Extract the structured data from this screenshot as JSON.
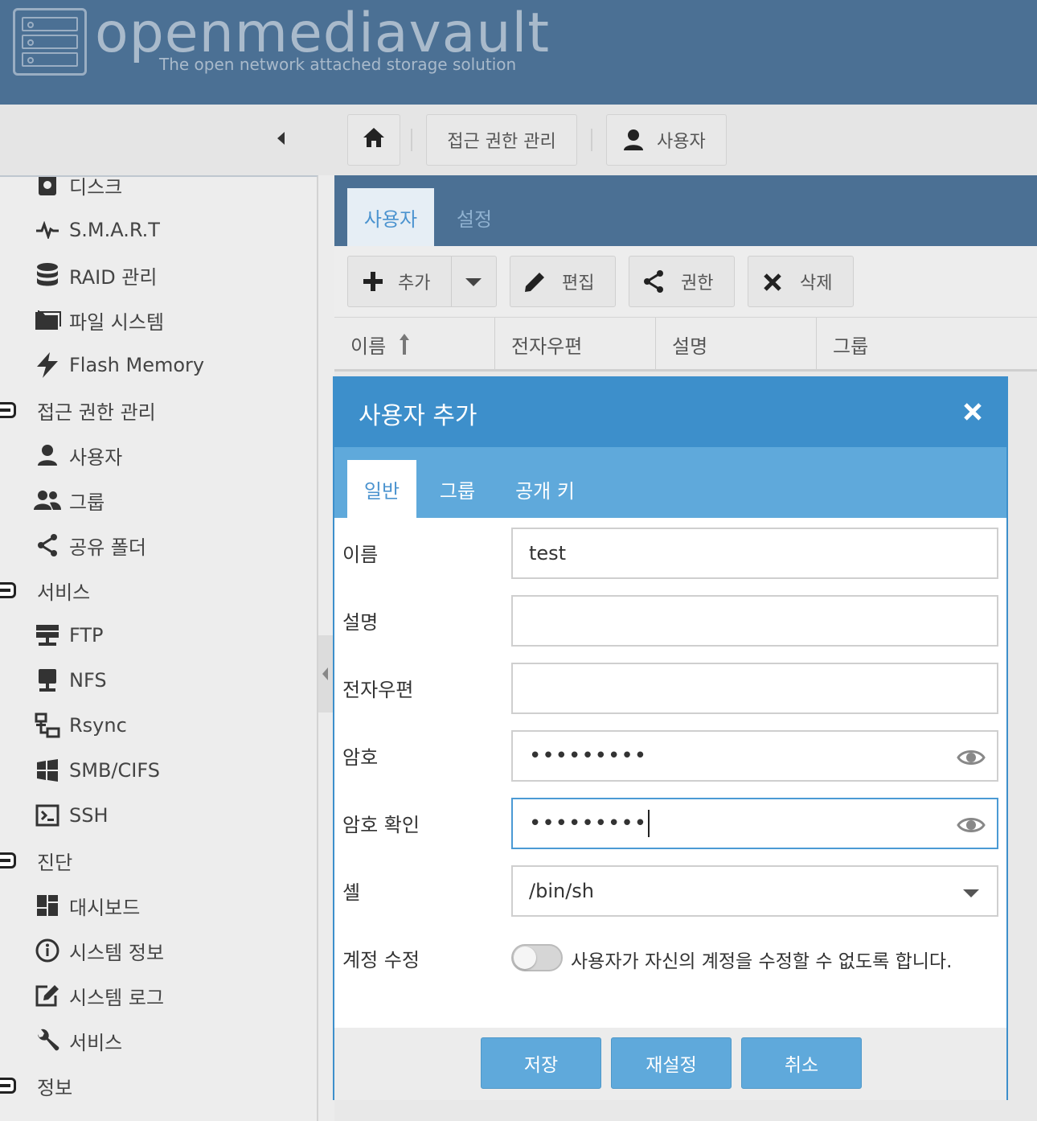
{
  "header": {
    "title": "openmediavault",
    "subtitle": "The open network attached storage solution"
  },
  "breadcrumb": {
    "home_icon": "home-icon",
    "items": [
      "접근 권한 관리",
      "사용자"
    ]
  },
  "sidebar": {
    "items": [
      {
        "label": "디스크",
        "icon": "disk-icon"
      },
      {
        "label": "S.M.A.R.T",
        "icon": "heartbeat-icon"
      },
      {
        "label": "RAID 관리",
        "icon": "database-icon"
      },
      {
        "label": "파일 시스템",
        "icon": "folder-icon"
      },
      {
        "label": "Flash Memory",
        "icon": "flash-icon"
      },
      {
        "label": "접근 권한 관리",
        "group": true
      },
      {
        "label": "사용자",
        "icon": "user-icon"
      },
      {
        "label": "그룹",
        "icon": "users-icon"
      },
      {
        "label": "공유 폴더",
        "icon": "share-icon"
      },
      {
        "label": "서비스",
        "group": true
      },
      {
        "label": "FTP",
        "icon": "server-icon"
      },
      {
        "label": "NFS",
        "icon": "monitor-icon"
      },
      {
        "label": "Rsync",
        "icon": "network-icon"
      },
      {
        "label": "SMB/CIFS",
        "icon": "windows-icon"
      },
      {
        "label": "SSH",
        "icon": "terminal-icon"
      },
      {
        "label": "진단",
        "group": true
      },
      {
        "label": "대시보드",
        "icon": "dashboard-icon"
      },
      {
        "label": "시스템 정보",
        "icon": "info-icon"
      },
      {
        "label": "시스템 로그",
        "icon": "edit-icon"
      },
      {
        "label": "서비스",
        "icon": "wrench-icon"
      },
      {
        "label": "정보",
        "group": true
      }
    ]
  },
  "panel": {
    "tabs": [
      "사용자",
      "설정"
    ],
    "toolbar": {
      "add": "추가",
      "edit": "편집",
      "privileges": "권한",
      "delete": "삭제"
    },
    "columns": [
      "이름",
      "전자우편",
      "설명",
      "그룹"
    ]
  },
  "dialog": {
    "title": "사용자 추가",
    "tabs": [
      "일반",
      "그룹",
      "공개 키"
    ],
    "fields": {
      "name_label": "이름",
      "name_value": "test",
      "desc_label": "설명",
      "desc_value": "",
      "email_label": "전자우편",
      "email_value": "",
      "password_label": "암호",
      "password_value": "•••••••••",
      "confirm_label": "암호 확인",
      "confirm_value": "•••••••••",
      "shell_label": "셸",
      "shell_value": "/bin/sh",
      "modify_label": "계정 수정",
      "modify_text": "사용자가 자신의 계정을 수정할 수 없도록 합니다.",
      "modify_enabled": false
    },
    "buttons": {
      "save": "저장",
      "reset": "재설정",
      "cancel": "취소"
    }
  },
  "colors": {
    "header_bg": "#4b7094",
    "dialog_accent": "#3d8fcb",
    "button_bg": "#5fa9db"
  }
}
